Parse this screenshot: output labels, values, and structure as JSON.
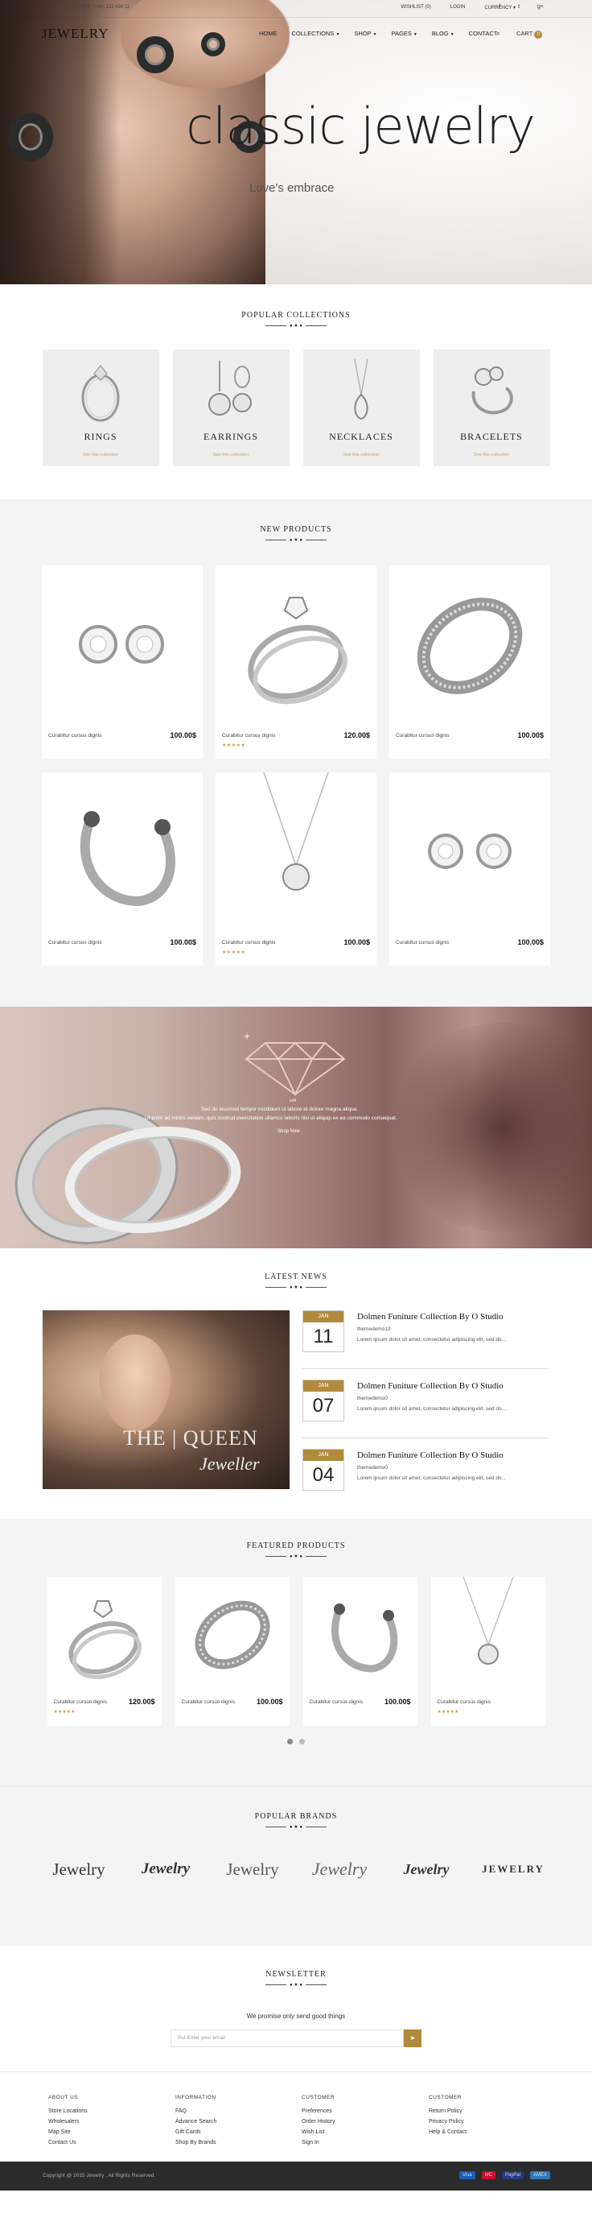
{
  "topbar": {
    "phone": "CALL US FREE: (+84) 123 456 11",
    "links": [
      "WISHLIST (0)",
      "LOGIN",
      "CURRENCY"
    ],
    "social": [
      "f",
      "t",
      "g+"
    ]
  },
  "nav": {
    "logo": "JEWELRY",
    "menu": [
      "HOME",
      "COLLECTIONS",
      "SHOP",
      "PAGES",
      "BLOG",
      "CONTACT"
    ],
    "cart_label": "CART",
    "cart_count": "0"
  },
  "hero": {
    "title": "classic jewelry",
    "subtitle": "Love's embrace"
  },
  "collections": {
    "title": "POPULAR COLLECTIONS",
    "items": [
      {
        "name": "RINGS",
        "link": "See this collection"
      },
      {
        "name": "EARRINGS",
        "link": "See this collection"
      },
      {
        "name": "NECKLACES",
        "link": "See this collection"
      },
      {
        "name": "BRACELETS",
        "link": "See this collection"
      }
    ]
  },
  "new_products": {
    "title": "NEW PRODUCTS",
    "items": [
      {
        "name": "Curabitur cursus dignis",
        "price": "100.00$",
        "stars": ""
      },
      {
        "name": "Curabitur cursus dignis",
        "price": "120.00$",
        "stars": "★★★★★"
      },
      {
        "name": "Curabitur cursus dignis",
        "price": "100.00$",
        "stars": ""
      },
      {
        "name": "Curabitur cursus dignis",
        "price": "100.00$",
        "stars": ""
      },
      {
        "name": "Curabitur cursus dignis",
        "price": "100.00$",
        "stars": "★★★★★"
      },
      {
        "name": "Curabitur cursus dignis",
        "price": "100.00$",
        "stars": ""
      }
    ]
  },
  "promo": {
    "small": "edit",
    "text1": "Sed do eiusmod tempor incididunt ut labore et dolore magna aliqua.",
    "text2": "Ut enim ad minim veniam, quis nostrud exercitation ullamco laboris nisi ut aliquip ex ea commodo consequat.",
    "button": "Shop Now"
  },
  "news": {
    "title": "LATEST NEWS",
    "image_title": "THE | QUEEN",
    "image_subtitle": "Jeweller",
    "items": [
      {
        "month": "JAN",
        "day": "11",
        "title": "Dolmen Funiture Collection By O Studio",
        "author": "themedemo13",
        "excerpt": "Lorem ipsum dolor sit amet, consectetur adipiscing elit, sed do..."
      },
      {
        "month": "JAN",
        "day": "07",
        "title": "Dolmen Funiture Collection By O Studio",
        "author": "themedemo0",
        "excerpt": "Lorem ipsum dolor sit amet, consectetur adipiscing elit, sed do..."
      },
      {
        "month": "JAN",
        "day": "04",
        "title": "Dolmen Funiture Collection By O Studio",
        "author": "themedemo0",
        "excerpt": "Lorem ipsum dolor sit amet, consectetur adipiscing elit, sed do..."
      }
    ]
  },
  "featured": {
    "title": "FEATURED PRODUCTS",
    "items": [
      {
        "name": "Curabitur cursus dignis",
        "price": "120.00$",
        "stars": "★★★★★"
      },
      {
        "name": "Curabitur cursus dignis",
        "price": "100.00$",
        "stars": ""
      },
      {
        "name": "Curabitur cursus dignis",
        "price": "100.00$",
        "stars": ""
      },
      {
        "name": "Curabitur cursus dignis",
        "price": "",
        "stars": "★★★★★"
      }
    ]
  },
  "brands": {
    "title": "POPULAR BRANDS",
    "items": [
      "Jewelry",
      "Jewelry",
      "Jewelry",
      "Jewelry",
      "Jewelry",
      "JEWELRY"
    ]
  },
  "newsletter": {
    "title": "NEWSLETTER",
    "text": "We promise only send good things",
    "placeholder": "Put Enter your email",
    "button": "➤"
  },
  "footer": {
    "columns": [
      {
        "heading": "ABOUT US",
        "links": [
          "Store Locations",
          "Wholesalers",
          "Map Site",
          "Contact Us"
        ]
      },
      {
        "heading": "INFORMATION",
        "links": [
          "FAQ",
          "Advance Search",
          "Gift Cards",
          "Shop By Brands"
        ]
      },
      {
        "heading": "CUSTOMER",
        "links": [
          "Preferences",
          "Order History",
          "Wish List",
          "Sign In"
        ]
      },
      {
        "heading": "CUSTOMER",
        "links": [
          "Return Policy",
          "Privacy Policy",
          "Help & Contact"
        ]
      }
    ],
    "copyright": "Copyright @ 2015 Jewelry . All Rights Reserved.",
    "payments": [
      "Visa",
      "MC",
      "PayPal",
      "AMEX"
    ]
  },
  "colors": {
    "accent": "#b08a3e",
    "dark": "#2b2b2b",
    "star": "#c9a13e"
  }
}
